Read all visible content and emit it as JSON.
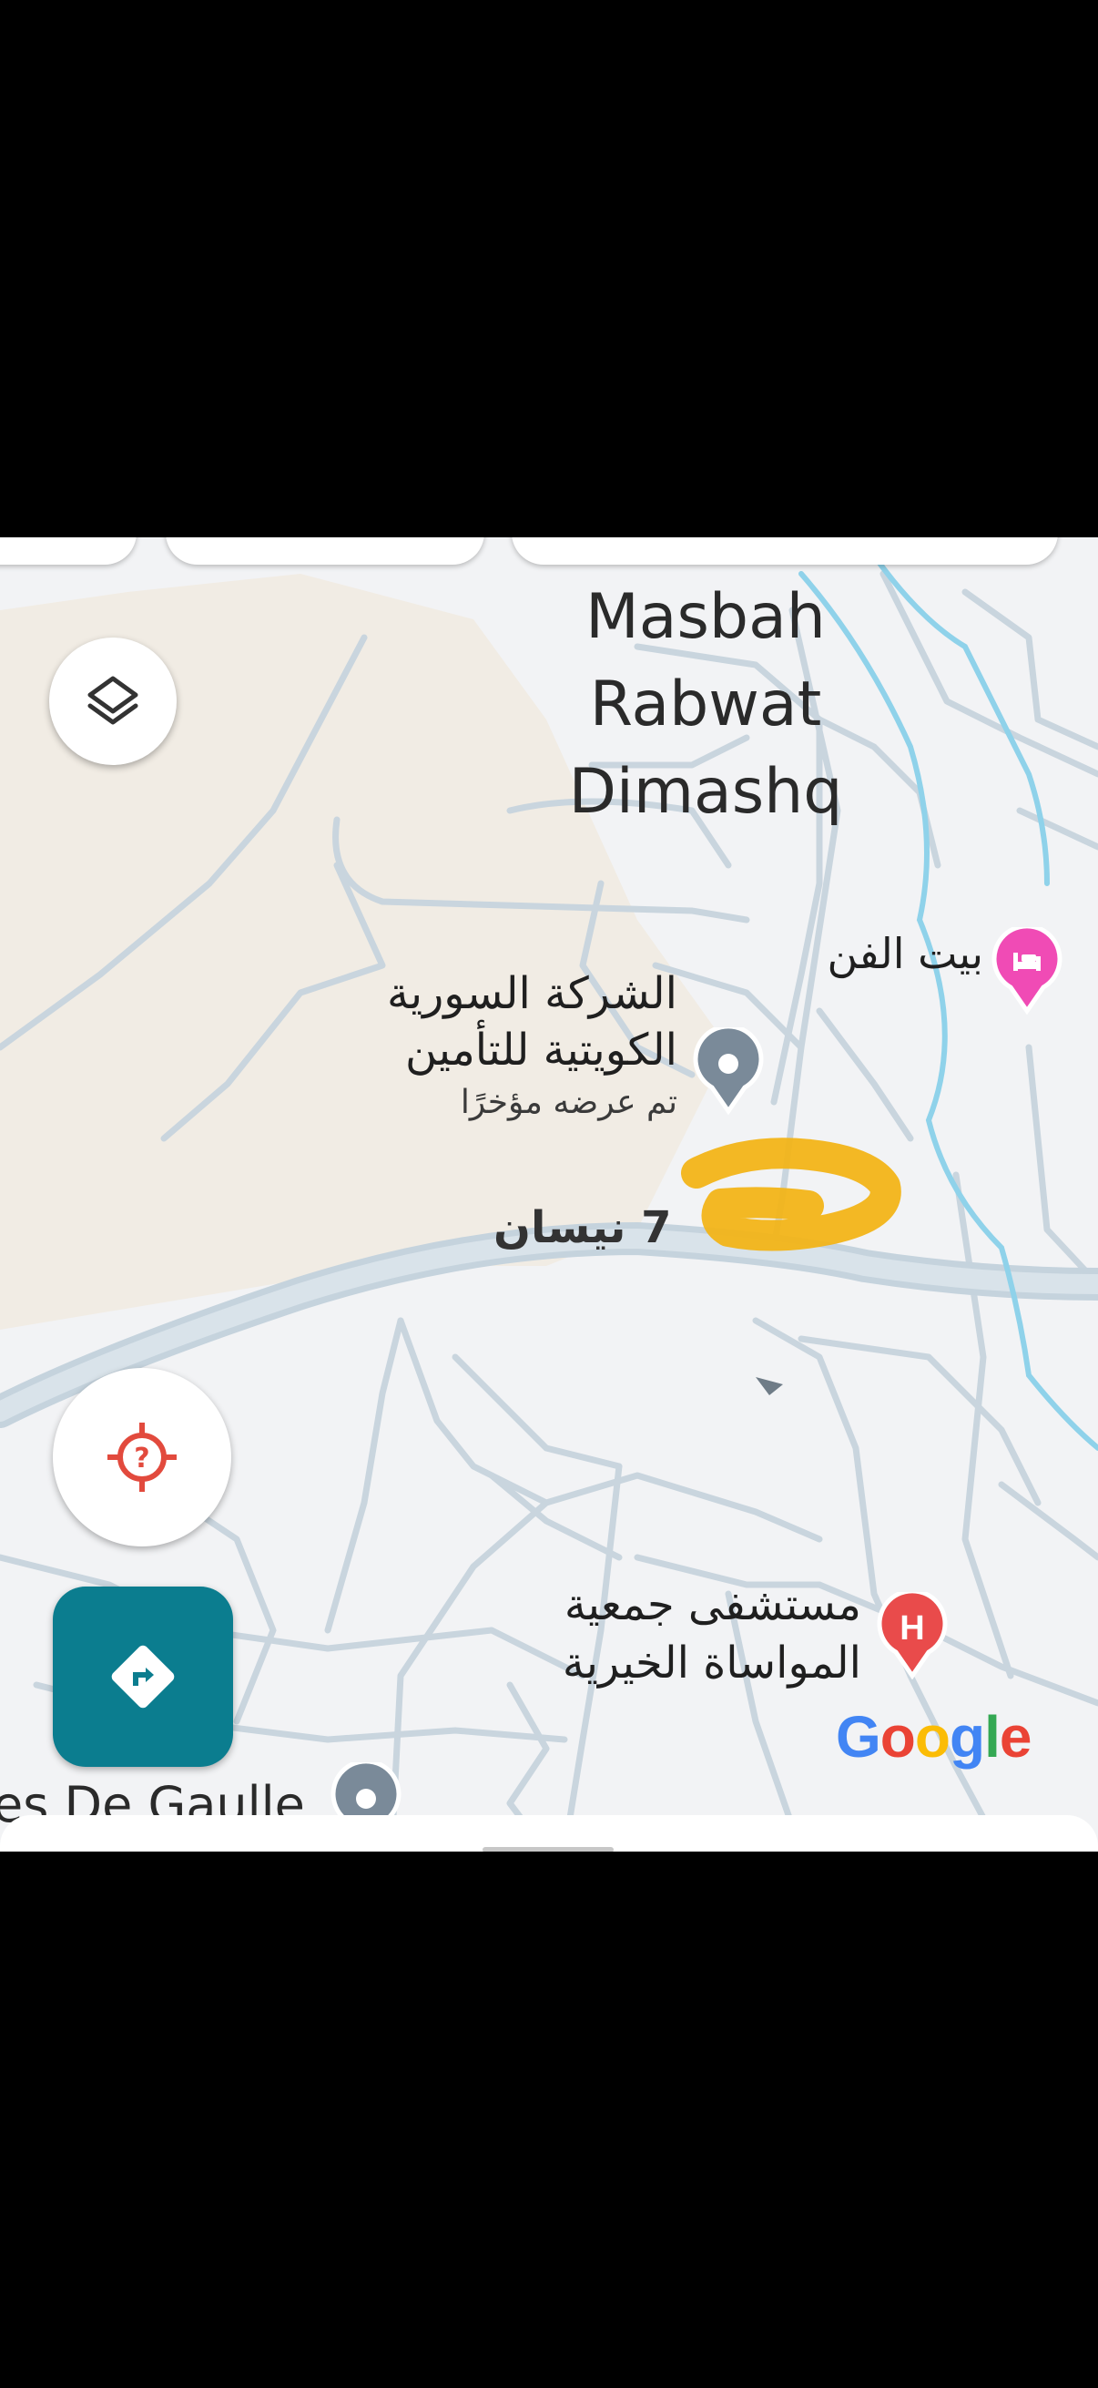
{
  "map": {
    "area_label_lines": [
      "Masbah",
      "Rabwat",
      "Dimashq"
    ],
    "places": {
      "hotel": {
        "name": "بيت الفن",
        "icon": "hotel-bed-icon",
        "color": "#f04bb5"
      },
      "insurance": {
        "name_lines": [
          "الشركة السورية",
          "الكويتية للتأمين"
        ],
        "subtitle": "تم عرضه مؤخرًا",
        "icon": "location-pin-icon",
        "color": "#7a8a99"
      },
      "hospital": {
        "name_lines": [
          "مستشفى جمعية",
          "المواساة الخيرية"
        ],
        "icon": "hospital-icon",
        "glyph": "H",
        "color": "#e94b4b"
      },
      "edge_place": {
        "name": "es De Gaulle",
        "icon": "location-pin-icon"
      }
    },
    "road_label": "7 نيسان",
    "annotation_color": "#f2b418",
    "google_logo": {
      "letters": [
        "G",
        "o",
        "o",
        "g",
        "l",
        "e"
      ],
      "colors": [
        "#4285f4",
        "#ea4335",
        "#fbbc05",
        "#4285f4",
        "#34a853",
        "#ea4335"
      ]
    }
  },
  "controls": {
    "layers_icon": "layers-icon",
    "location_icon": "location-unknown-icon",
    "location_glyph": "?",
    "directions_icon": "directions-icon",
    "directions_color": "#0b7d8f"
  }
}
